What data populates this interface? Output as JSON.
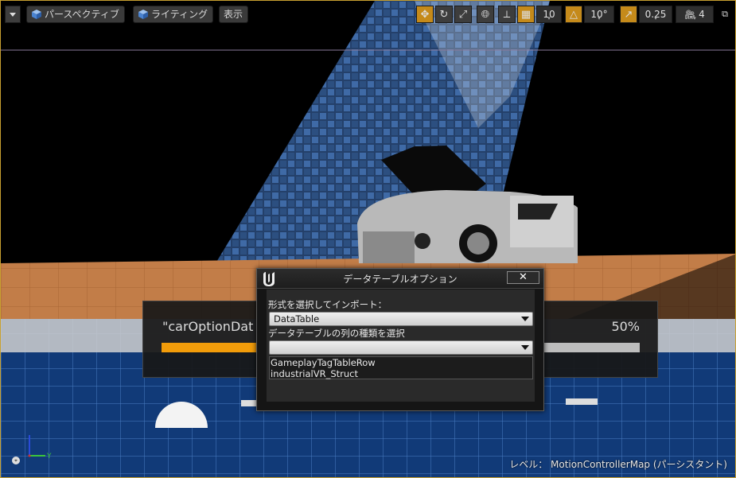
{
  "toolbar": {
    "viewport_menu_icon": "chevron-down-icon",
    "perspective_label": "パースペクティブ",
    "lighting_label": "ライティング",
    "show_label": "表示",
    "grid_snap_value": "10",
    "rotation_snap_value": "10°",
    "scale_snap_value": "0.25",
    "camera_speed_value": "4",
    "icons": [
      "translate-icon",
      "rotate-icon",
      "scale-icon",
      "world-icon",
      "surface-snap-icon",
      "grid-snap-icon",
      "rotation-snap-icon",
      "scale-snap-icon",
      "camera-speed-icon",
      "maximize-icon"
    ],
    "accent": "#c58a1a"
  },
  "progress": {
    "title": "\"carOptionDat",
    "percent_text": "50%",
    "fraction": 0.5,
    "fill_color": "#f29c0a"
  },
  "dialog": {
    "title": "データテーブルオプション",
    "close_label": "✕",
    "import_type_label": "形式を選択してインポート：",
    "import_type_value": "DataTable",
    "row_type_label": "データテーブルの列の種類を選択",
    "row_type_value": "",
    "row_type_options": [
      "GameplayTagTableRow",
      "industrialVR_Struct"
    ]
  },
  "status": {
    "level_text": "レベル：  MotionControllerMap (パーシスタント)"
  },
  "axis": {
    "y_label": "Y"
  }
}
